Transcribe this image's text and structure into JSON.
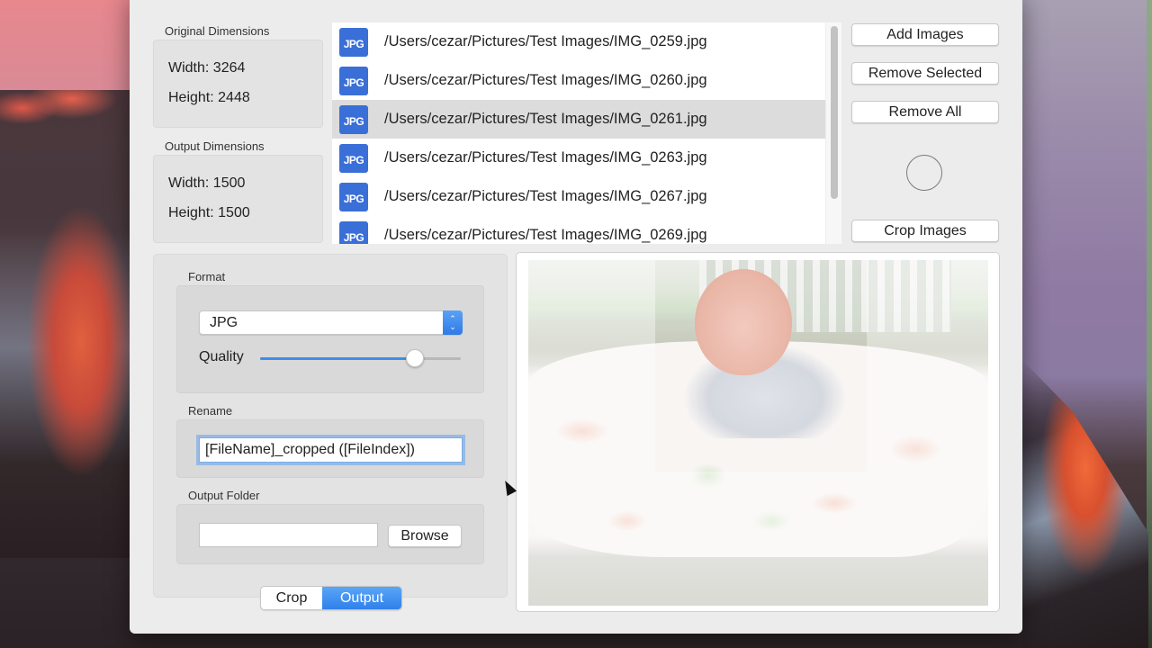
{
  "original_dimensions": {
    "label": "Original Dimensions",
    "width_text": "Width: 3264",
    "height_text": "Height: 2448"
  },
  "output_dimensions": {
    "label": "Output Dimensions",
    "width_text": "Width: 1500",
    "height_text": "Height: 1500"
  },
  "file_list": {
    "icon_label": "JPG",
    "items": [
      {
        "path": "/Users/cezar/Pictures/Test Images/IMG_0259.jpg",
        "selected": false
      },
      {
        "path": "/Users/cezar/Pictures/Test Images/IMG_0260.jpg",
        "selected": false
      },
      {
        "path": "/Users/cezar/Pictures/Test Images/IMG_0261.jpg",
        "selected": true
      },
      {
        "path": "/Users/cezar/Pictures/Test Images/IMG_0263.jpg",
        "selected": false
      },
      {
        "path": "/Users/cezar/Pictures/Test Images/IMG_0267.jpg",
        "selected": false
      },
      {
        "path": "/Users/cezar/Pictures/Test Images/IMG_0269.jpg",
        "selected": false
      }
    ]
  },
  "actions": {
    "add_images": "Add Images",
    "remove_selected": "Remove Selected",
    "remove_all": "Remove All",
    "crop_images": "Crop Images"
  },
  "format": {
    "label": "Format",
    "selected": "JPG",
    "quality_label": "Quality",
    "quality_fraction": 0.77
  },
  "rename": {
    "label": "Rename",
    "value": "[FileName]_cropped ([FileIndex])"
  },
  "output_folder": {
    "label": "Output Folder",
    "value": "",
    "browse_label": "Browse"
  },
  "tabs": [
    {
      "label": "Crop",
      "active": false
    },
    {
      "label": "Output",
      "active": true
    }
  ],
  "colors": {
    "accent": "#3e8ee8",
    "file_icon": "#3a6fd8",
    "selection": "#dcdcdc"
  }
}
